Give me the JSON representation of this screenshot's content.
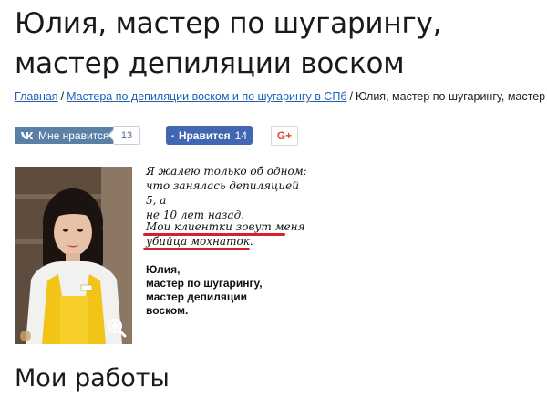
{
  "page": {
    "title": "Юлия, мастер по шугарингу, мастер депиляции воском"
  },
  "breadcrumb": {
    "home": "Главная",
    "section": "Мастера по депиляции воском и по шугарингу в СПб",
    "current": "Юлия, мастер по шугарингу, мастер депиляции воском"
  },
  "social": {
    "vk_label": "Мне нравится",
    "vk_count": "13",
    "fb_label": "Нравится",
    "fb_count": "14",
    "gplus_label": "G+",
    "colors": {
      "vk": "#5b80a5",
      "fb": "#4267b2",
      "gplus": "#dd4b39"
    }
  },
  "profile": {
    "quote_line1": "Я жалею только об одном:",
    "quote_line2": "что занялась депиляцией 5, а",
    "quote_line3": "не 10 лет назад.",
    "highlight_line1": "Мои клиентки зовут меня",
    "highlight_line2": "убийца мохнаток.",
    "sign_line1": "Юлия,",
    "sign_line2": "мастер по шугарингу,",
    "sign_line3": "мастер депиляции",
    "sign_line4": "воском.",
    "highlight_color": "#d9202a",
    "photo_icon": "zoom-in-icon"
  },
  "works": {
    "heading": "Мои работы"
  }
}
